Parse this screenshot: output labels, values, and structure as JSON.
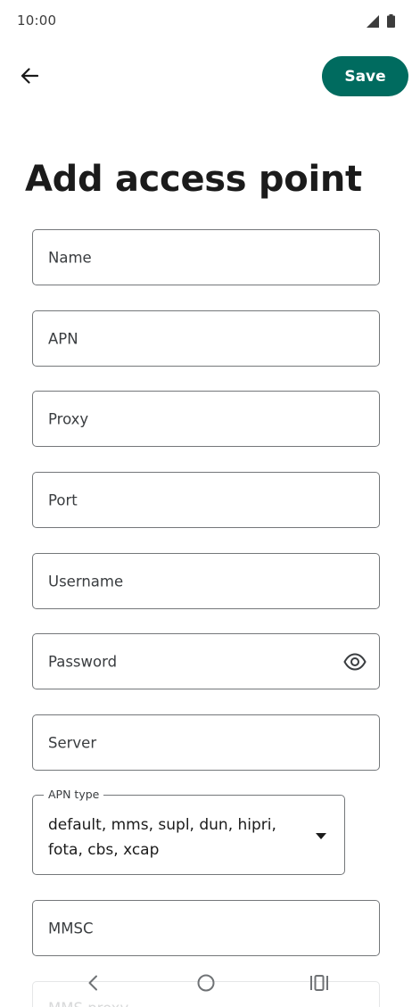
{
  "status_bar": {
    "time": "10:00",
    "icons": [
      "signal-icon",
      "battery-icon"
    ]
  },
  "header": {
    "back_icon": "arrow-back-icon",
    "save_label": "Save"
  },
  "page": {
    "title": "Add access point"
  },
  "fields": [
    {
      "label": "Name"
    },
    {
      "label": "APN"
    },
    {
      "label": "Proxy"
    },
    {
      "label": "Port"
    },
    {
      "label": "Username"
    },
    {
      "label": "Password",
      "trailing_icon": "eye-icon"
    },
    {
      "label": "Server"
    }
  ],
  "apn_type": {
    "label": "APN type",
    "value": "default, mms, supl, dun, hipri, fota, cbs, xcap",
    "dropdown_icon": "triangle-down-icon"
  },
  "mmsc": {
    "label": "MMSC"
  },
  "mms_proxy": {
    "label": "MMS proxy"
  },
  "nav_bar": {
    "icons": [
      "nav-back-icon",
      "nav-home-icon",
      "nav-recents-icon"
    ]
  },
  "colors": {
    "accent": "#006b5f",
    "outline": "#74777a",
    "text": "#1b1b1b"
  }
}
